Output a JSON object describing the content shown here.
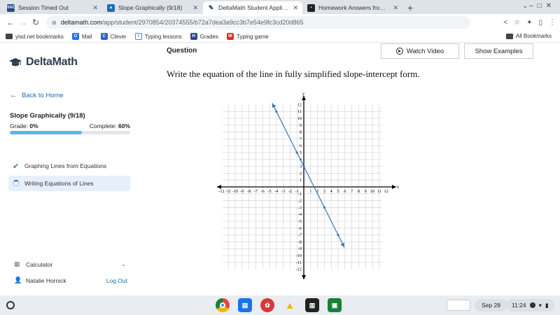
{
  "browser": {
    "tabs": [
      {
        "label": "Session Timed Out",
        "favicon_text": "HAC",
        "favicon_color": "#2b4a8a",
        "active": false
      },
      {
        "label": "Slope Graphically (9/18)",
        "favicon_text": "",
        "favicon_color": "#1a6fb3",
        "active": false
      },
      {
        "label": "DeltaMath Student Application",
        "favicon_text": "",
        "favicon_color": "#2c3e50",
        "active": true
      },
      {
        "label": "Homework Answers from Subje",
        "favicon_text": "",
        "favicon_color": "#222222",
        "active": false
      }
    ],
    "new_tab": "+",
    "url_host": "deltamath.com",
    "url_path": "/app/student/2970854/20374555/b72a7dea3a9cc3b7e54e9fc3cd20d865",
    "bookmarks": [
      {
        "label": "yisd.net bookmarks",
        "color": "#444444"
      },
      {
        "label": "Mail",
        "color": "#1a73e8"
      },
      {
        "label": "Clever",
        "color": "#2d63c8"
      },
      {
        "label": "Typing lessons",
        "color": "#3b8ad9"
      },
      {
        "label": "Grades",
        "color": "#2b4a8a"
      },
      {
        "label": "Typing game",
        "color": "#d93025"
      }
    ],
    "all_bookmarks": "All Bookmarks"
  },
  "sidebar": {
    "brand": "DeltaMath",
    "back_label": "Back to Home",
    "assignment_title": "Slope Graphically (9/18)",
    "grade_label": "Grade:",
    "grade_value": "0%",
    "complete_label": "Complete:",
    "complete_value": "60%",
    "progress_fraction": 0.6,
    "skills": [
      {
        "label": "Graphing Lines from Equations",
        "status": "complete"
      },
      {
        "label": "Writing Equations of Lines",
        "status": "in-progress"
      }
    ],
    "calculator_label": "Calculator",
    "user_name": "Natalie Hornick",
    "logout_label": "Log Out"
  },
  "main": {
    "question_heading": "Question",
    "watch_video_label": "Watch Video",
    "show_examples_label": "Show Examples",
    "prompt": "Write the equation of the line in fully simplified slope-intercept form."
  },
  "graph": {
    "x_axis_label": "x",
    "y_axis_label": "y",
    "x_range": [
      -12,
      12
    ],
    "y_range": [
      -12,
      12
    ],
    "tick_step": 1,
    "line": {
      "slope": -2,
      "intercept": 3
    },
    "points": [
      [
        -4,
        11
      ],
      [
        -1,
        5
      ],
      [
        0,
        3
      ],
      [
        3,
        -3
      ],
      [
        5,
        -7
      ]
    ],
    "line_color": "#3a78b5"
  },
  "taskbar": {
    "date": "Sep 28",
    "time": "11:24",
    "apps": [
      {
        "name": "chrome",
        "color": "#e8453c"
      },
      {
        "name": "classroom",
        "color": "#1a73e8"
      },
      {
        "name": "game",
        "color": "#d93838"
      },
      {
        "name": "drive",
        "color": "#f2b400"
      },
      {
        "name": "notes",
        "color": "#222222"
      },
      {
        "name": "slides",
        "color": "#188038"
      }
    ]
  }
}
